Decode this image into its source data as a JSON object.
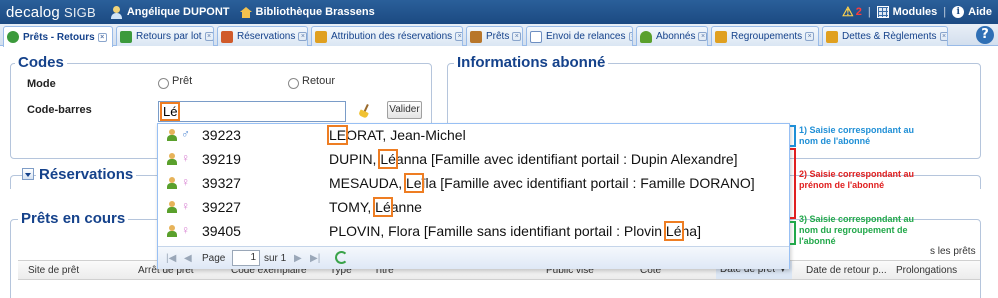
{
  "topbar": {
    "logo": "decalog",
    "logo_suffix": "SIGB",
    "user": "Angélique DUPONT",
    "library": "Bibliothèque Brassens",
    "alert_count": "2",
    "modules": "Modules",
    "help": "Aide"
  },
  "tabs": [
    {
      "label": "Prêts - Retours",
      "icon": "refresh-icon",
      "color": "#3c9a3c"
    },
    {
      "label": "Retours par lot",
      "icon": "return-icon",
      "color": "#3c9a3c"
    },
    {
      "label": "Réservations",
      "icon": "calendar-icon",
      "color": "#d05a2a"
    },
    {
      "label": "Attribution des réservations",
      "icon": "assign-icon",
      "color": "#e0a020"
    },
    {
      "label": "Prêts",
      "icon": "books-icon",
      "color": "#b8762a"
    },
    {
      "label": "Envoi de relances",
      "icon": "mail-icon",
      "color": "#6e8fc2"
    },
    {
      "label": "Abonnés",
      "icon": "users-icon",
      "color": "#5aa02c"
    },
    {
      "label": "Regroupements",
      "icon": "group-icon",
      "color": "#e0a020"
    },
    {
      "label": "Dettes & Règlements",
      "icon": "money-icon",
      "color": "#e0a020"
    }
  ],
  "codes": {
    "legend": "Codes",
    "mode_label": "Mode",
    "radio_pret": "Prêt",
    "radio_retour": "Retour",
    "barcode_label": "Code-barres",
    "barcode_value": "Lé",
    "valider": "Valider"
  },
  "abonne": {
    "legend": "Informations abonné"
  },
  "reservations": {
    "legend": "Réservations"
  },
  "prets": {
    "legend": "Prêts en cours",
    "side_text": "s les prêts",
    "columns": [
      "Site de prêt",
      "Arrêt de prêt",
      "Code exemplaire",
      "Type",
      "Titre",
      "Public visé",
      "Cote",
      "Date de prêt",
      "Date de retour p...",
      "Prolongations"
    ]
  },
  "suggestions": [
    {
      "gender": "male",
      "id": "39223",
      "before": "",
      "match": "LE",
      "after": "ORAT, Jean-Michel"
    },
    {
      "gender": "female",
      "id": "39219",
      "before": "DUPIN, ",
      "match": "Lé",
      "after": "anna [Famille avec identifiant portail : Dupin Alexandre]"
    },
    {
      "gender": "female",
      "id": "39327",
      "before": "MESAUDA, ",
      "match": "Le",
      "after": "ïla [Famille avec identifiant portail : Famille DORANO]"
    },
    {
      "gender": "female",
      "id": "39227",
      "before": "TOMY, ",
      "match": "Lé",
      "after": "anne"
    },
    {
      "gender": "female",
      "id": "39405",
      "before": "PLOVIN, Flora [Famille sans identifiant portail : Plovin ",
      "match": "Lé",
      "after": "na]"
    }
  ],
  "pager": {
    "page_label": "Page",
    "page_value": "1",
    "of_label": "sur 1"
  },
  "annotations": [
    {
      "text": "1) Saisie correspondant au nom de l'abonné",
      "color": "#1f8fd6"
    },
    {
      "text": "2) Saisie correspondant au prénom de l'abonné",
      "color": "#e02020"
    },
    {
      "text": "3) Saisie correspondant au nom du regroupement de l'abonné",
      "color": "#22a84a"
    }
  ]
}
